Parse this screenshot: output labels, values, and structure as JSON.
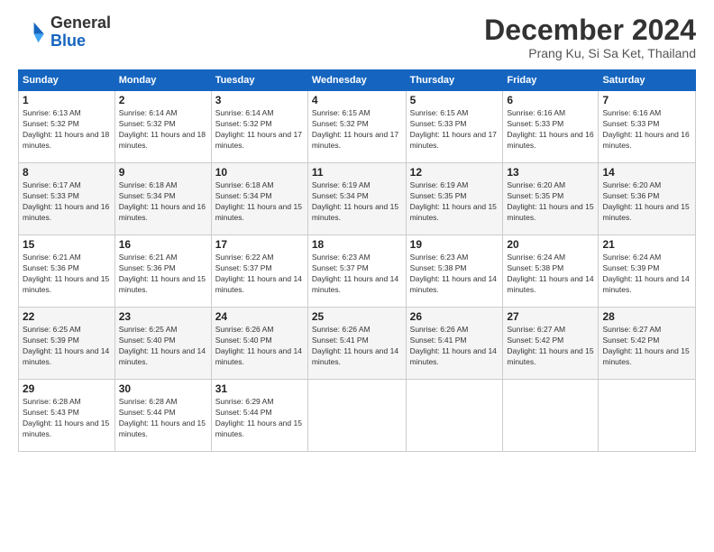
{
  "header": {
    "logo": {
      "general": "General",
      "blue": "Blue"
    },
    "title": "December 2024",
    "location": "Prang Ku, Si Sa Ket, Thailand"
  },
  "weekdays": [
    "Sunday",
    "Monday",
    "Tuesday",
    "Wednesday",
    "Thursday",
    "Friday",
    "Saturday"
  ],
  "weeks": [
    [
      {
        "day": "1",
        "sunrise": "6:13 AM",
        "sunset": "5:32 PM",
        "daylight": "11 hours and 18 minutes."
      },
      {
        "day": "2",
        "sunrise": "6:14 AM",
        "sunset": "5:32 PM",
        "daylight": "11 hours and 18 minutes."
      },
      {
        "day": "3",
        "sunrise": "6:14 AM",
        "sunset": "5:32 PM",
        "daylight": "11 hours and 17 minutes."
      },
      {
        "day": "4",
        "sunrise": "6:15 AM",
        "sunset": "5:32 PM",
        "daylight": "11 hours and 17 minutes."
      },
      {
        "day": "5",
        "sunrise": "6:15 AM",
        "sunset": "5:33 PM",
        "daylight": "11 hours and 17 minutes."
      },
      {
        "day": "6",
        "sunrise": "6:16 AM",
        "sunset": "5:33 PM",
        "daylight": "11 hours and 16 minutes."
      },
      {
        "day": "7",
        "sunrise": "6:16 AM",
        "sunset": "5:33 PM",
        "daylight": "11 hours and 16 minutes."
      }
    ],
    [
      {
        "day": "8",
        "sunrise": "6:17 AM",
        "sunset": "5:33 PM",
        "daylight": "11 hours and 16 minutes."
      },
      {
        "day": "9",
        "sunrise": "6:18 AM",
        "sunset": "5:34 PM",
        "daylight": "11 hours and 16 minutes."
      },
      {
        "day": "10",
        "sunrise": "6:18 AM",
        "sunset": "5:34 PM",
        "daylight": "11 hours and 15 minutes."
      },
      {
        "day": "11",
        "sunrise": "6:19 AM",
        "sunset": "5:34 PM",
        "daylight": "11 hours and 15 minutes."
      },
      {
        "day": "12",
        "sunrise": "6:19 AM",
        "sunset": "5:35 PM",
        "daylight": "11 hours and 15 minutes."
      },
      {
        "day": "13",
        "sunrise": "6:20 AM",
        "sunset": "5:35 PM",
        "daylight": "11 hours and 15 minutes."
      },
      {
        "day": "14",
        "sunrise": "6:20 AM",
        "sunset": "5:36 PM",
        "daylight": "11 hours and 15 minutes."
      }
    ],
    [
      {
        "day": "15",
        "sunrise": "6:21 AM",
        "sunset": "5:36 PM",
        "daylight": "11 hours and 15 minutes."
      },
      {
        "day": "16",
        "sunrise": "6:21 AM",
        "sunset": "5:36 PM",
        "daylight": "11 hours and 15 minutes."
      },
      {
        "day": "17",
        "sunrise": "6:22 AM",
        "sunset": "5:37 PM",
        "daylight": "11 hours and 14 minutes."
      },
      {
        "day": "18",
        "sunrise": "6:23 AM",
        "sunset": "5:37 PM",
        "daylight": "11 hours and 14 minutes."
      },
      {
        "day": "19",
        "sunrise": "6:23 AM",
        "sunset": "5:38 PM",
        "daylight": "11 hours and 14 minutes."
      },
      {
        "day": "20",
        "sunrise": "6:24 AM",
        "sunset": "5:38 PM",
        "daylight": "11 hours and 14 minutes."
      },
      {
        "day": "21",
        "sunrise": "6:24 AM",
        "sunset": "5:39 PM",
        "daylight": "11 hours and 14 minutes."
      }
    ],
    [
      {
        "day": "22",
        "sunrise": "6:25 AM",
        "sunset": "5:39 PM",
        "daylight": "11 hours and 14 minutes."
      },
      {
        "day": "23",
        "sunrise": "6:25 AM",
        "sunset": "5:40 PM",
        "daylight": "11 hours and 14 minutes."
      },
      {
        "day": "24",
        "sunrise": "6:26 AM",
        "sunset": "5:40 PM",
        "daylight": "11 hours and 14 minutes."
      },
      {
        "day": "25",
        "sunrise": "6:26 AM",
        "sunset": "5:41 PM",
        "daylight": "11 hours and 14 minutes."
      },
      {
        "day": "26",
        "sunrise": "6:26 AM",
        "sunset": "5:41 PM",
        "daylight": "11 hours and 14 minutes."
      },
      {
        "day": "27",
        "sunrise": "6:27 AM",
        "sunset": "5:42 PM",
        "daylight": "11 hours and 15 minutes."
      },
      {
        "day": "28",
        "sunrise": "6:27 AM",
        "sunset": "5:42 PM",
        "daylight": "11 hours and 15 minutes."
      }
    ],
    [
      {
        "day": "29",
        "sunrise": "6:28 AM",
        "sunset": "5:43 PM",
        "daylight": "11 hours and 15 minutes."
      },
      {
        "day": "30",
        "sunrise": "6:28 AM",
        "sunset": "5:44 PM",
        "daylight": "11 hours and 15 minutes."
      },
      {
        "day": "31",
        "sunrise": "6:29 AM",
        "sunset": "5:44 PM",
        "daylight": "11 hours and 15 minutes."
      },
      null,
      null,
      null,
      null
    ]
  ]
}
